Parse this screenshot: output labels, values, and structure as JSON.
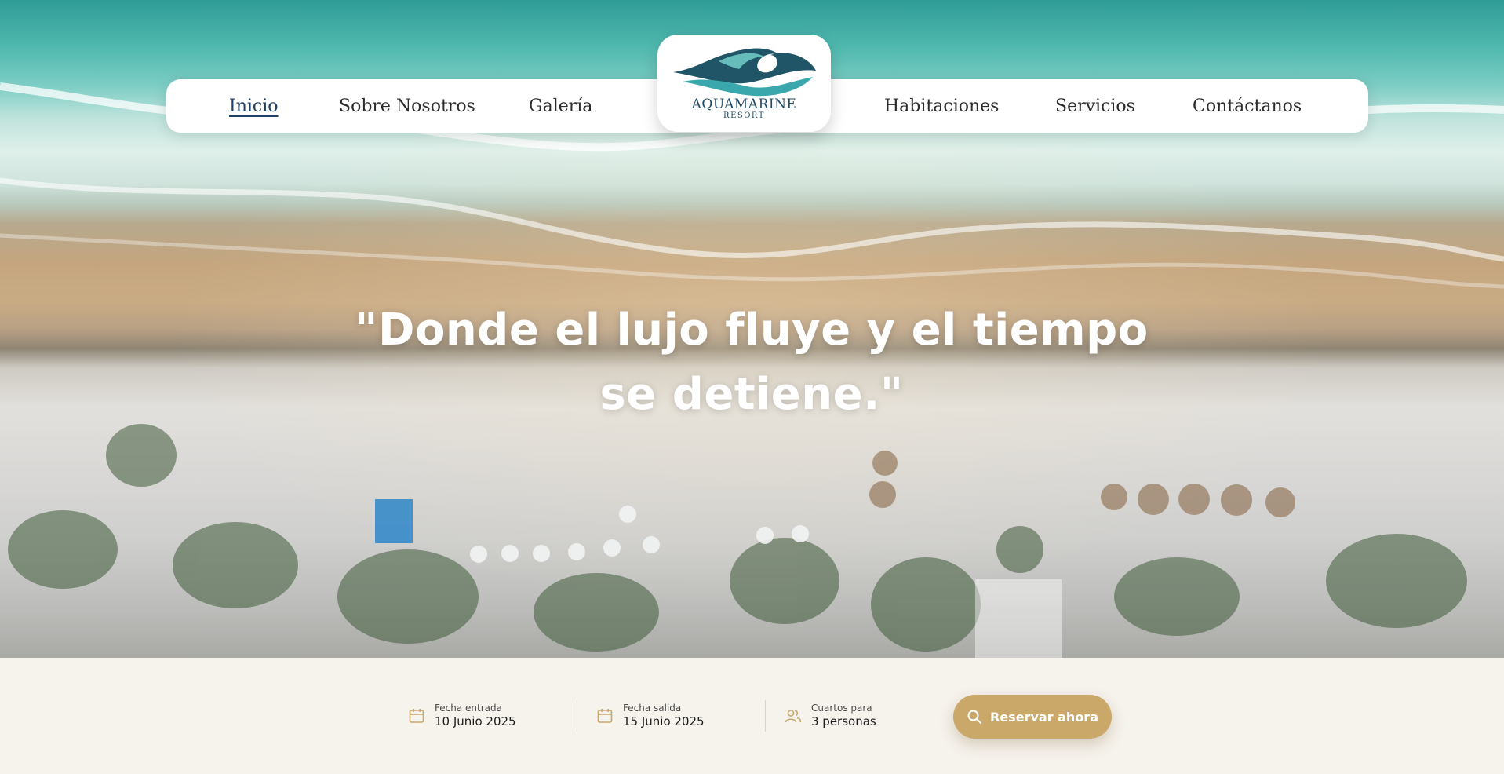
{
  "nav": {
    "items": [
      {
        "label": "Inicio",
        "active": true
      },
      {
        "label": "Sobre Nosotros"
      },
      {
        "label": "Galería"
      },
      {
        "label": "Habitaciones"
      },
      {
        "label": "Servicios"
      },
      {
        "label": "Contáctanos"
      }
    ]
  },
  "logo": {
    "name": "AQUAMARINE",
    "subtitle": "RESORT",
    "icon": "wave-icon"
  },
  "hero": {
    "headline_line1": "\"Donde el lujo fluye y el tiempo",
    "headline_line2": "se detiene.\"",
    "background": "aerial-beach-photo"
  },
  "booking": {
    "checkin": {
      "label": "Fecha entrada",
      "value": "10 Junio 2025",
      "icon": "calendar-icon"
    },
    "checkout": {
      "label": "Fecha salida",
      "value": "15 Junio 2025",
      "icon": "calendar-icon"
    },
    "rooms": {
      "label": "Cuartos para",
      "value": "3 personas",
      "icon": "users-icon"
    },
    "cta_label": "Reservar ahora",
    "cta_icon": "search-icon"
  },
  "colors": {
    "accent": "#c9a86a",
    "nav_active": "#1f3f66",
    "logo_teal": "#2a8c94",
    "booking_bg": "#f6f2ec"
  }
}
